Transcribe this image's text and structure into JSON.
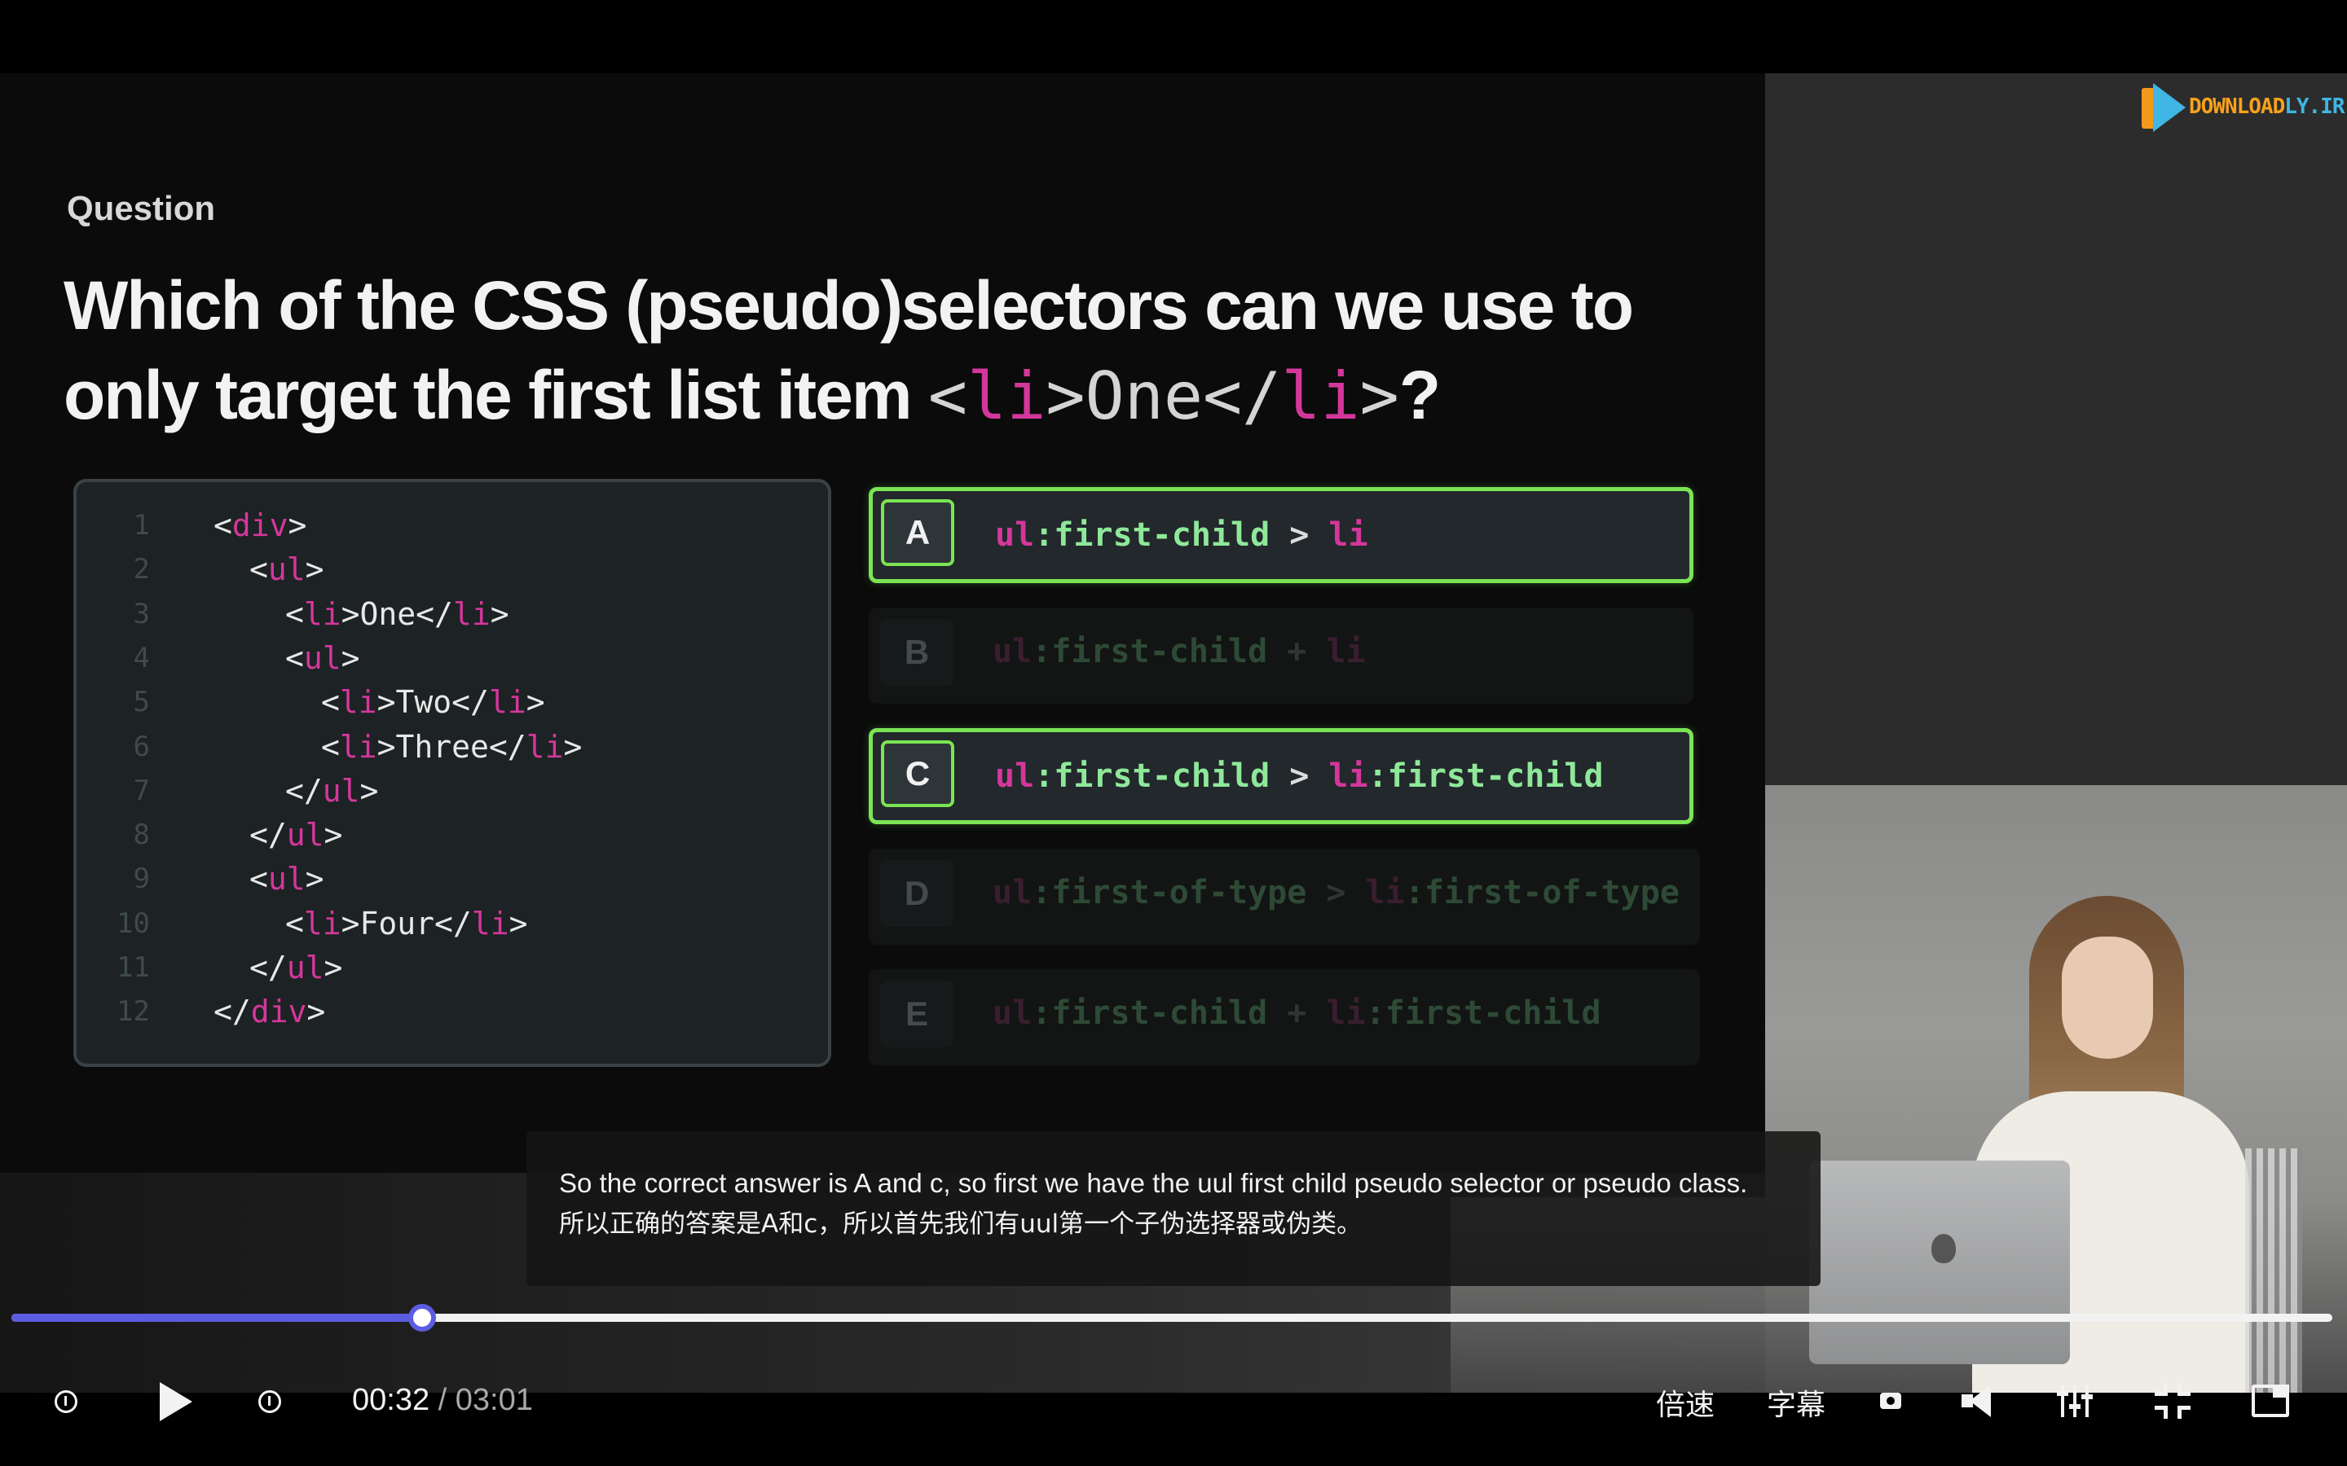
{
  "video": {
    "watermark": {
      "part1": "DOWNLOAD",
      "part2": "LY.IR"
    },
    "slide": {
      "label": "Question",
      "title_line1": "Which of the CSS (pseudo)selectors can we use to",
      "title_line2_text": "only target the first list item ",
      "title_code": {
        "open_lt": "<",
        "tag": "li",
        "open_gt": ">One</",
        "close_tag": "li",
        "close_gt": ">"
      },
      "title_end": "?",
      "code_lines": [
        {
          "n": "1",
          "parts": [
            "<",
            "div",
            ">"
          ]
        },
        {
          "n": "2",
          "parts": [
            "<",
            "ul",
            ">"
          ]
        },
        {
          "n": "3",
          "parts": [
            "<",
            "li",
            ">One</",
            "li",
            ">"
          ]
        },
        {
          "n": "4",
          "parts": [
            "<",
            "ul",
            ">"
          ]
        },
        {
          "n": "5",
          "parts": [
            "<",
            "li",
            ">Two</",
            "li",
            ">"
          ]
        },
        {
          "n": "6",
          "parts": [
            "<",
            "li",
            ">Three</",
            "li",
            ">"
          ]
        },
        {
          "n": "7",
          "parts": [
            "</",
            "ul",
            ">"
          ]
        },
        {
          "n": "8",
          "parts": [
            "</",
            "ul",
            ">"
          ]
        },
        {
          "n": "9",
          "parts": [
            "<",
            "ul",
            ">"
          ]
        },
        {
          "n": "10",
          "parts": [
            "<",
            "li",
            ">Four</",
            "li",
            ">"
          ]
        },
        {
          "n": "11",
          "parts": [
            "</",
            "ul",
            ">"
          ]
        },
        {
          "n": "12",
          "parts": [
            "</",
            "div",
            ">"
          ]
        }
      ],
      "options": [
        {
          "letter": "A",
          "t1": "ul",
          "p1": ":first-child",
          "op": " > ",
          "t2": "li",
          "p2": "",
          "state": "correct"
        },
        {
          "letter": "B",
          "t1": "ul",
          "p1": ":first-child",
          "op": " + ",
          "t2": "li",
          "p2": "",
          "state": "faded"
        },
        {
          "letter": "C",
          "t1": "ul",
          "p1": ":first-child",
          "op": " > ",
          "t2": "li",
          "p2": ":first-child",
          "state": "correct"
        },
        {
          "letter": "D",
          "t1": "ul",
          "p1": ":first-of-type",
          "op": " > ",
          "t2": "li",
          "p2": ":first-of-type",
          "state": "faded"
        },
        {
          "letter": "E",
          "t1": "ul",
          "p1": ":first-child",
          "op": " + ",
          "t2": "li",
          "p2": ":first-child",
          "state": "faded"
        }
      ]
    },
    "subtitle": {
      "en": "So the correct answer is A and c, so first we have the uul first child pseudo selector or pseudo class.",
      "zh": "所以正确的答案是A和c，所以首先我们有uul第一个子伪选择器或伪类。"
    }
  },
  "player": {
    "progress_fraction": 0.177,
    "current_time": "00:32",
    "separator": "/",
    "duration": "03:01",
    "speed_label": "倍速",
    "captions_label": "字幕",
    "colors": {
      "accent": "#5c5ce0",
      "correct": "#7be454",
      "tag": "#d4379b"
    }
  }
}
